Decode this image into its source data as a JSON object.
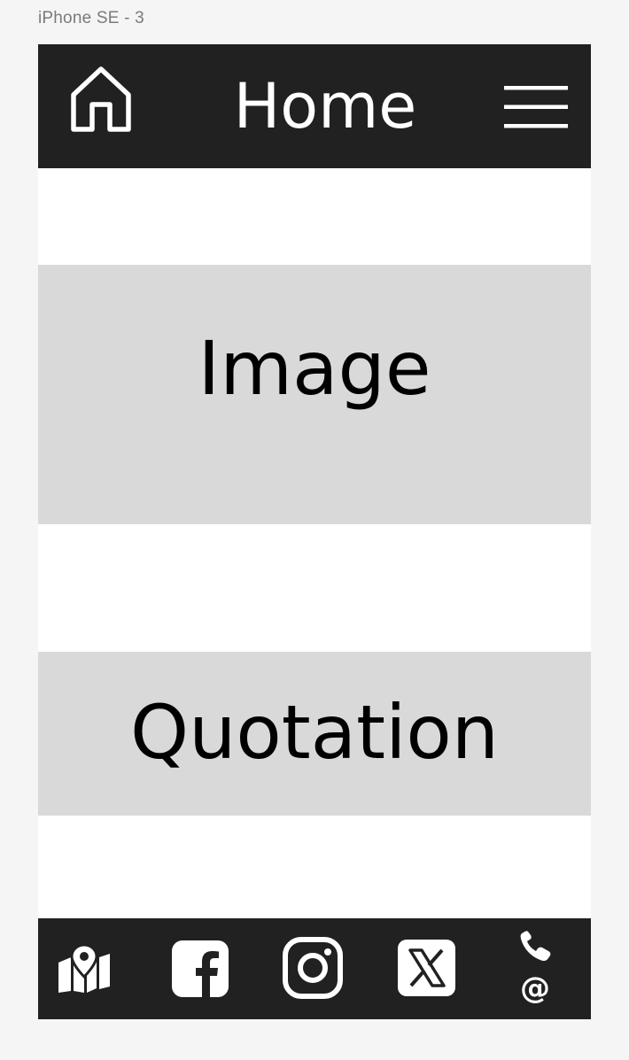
{
  "frame_label": "iPhone SE - 3",
  "header": {
    "title": "Home",
    "home_icon": "home-icon",
    "menu_icon": "hamburger-menu-icon",
    "background": "#212121",
    "text_color": "#ffffff"
  },
  "main": {
    "image_placeholder": "Image",
    "quote_placeholder": "Quotation",
    "placeholder_background": "#d9d9d9",
    "content_background": "#ffffff"
  },
  "footer": {
    "background": "#212121",
    "icons": [
      "map-icon",
      "facebook-icon",
      "instagram-icon",
      "x-twitter-icon",
      "phone-email-icon"
    ]
  }
}
